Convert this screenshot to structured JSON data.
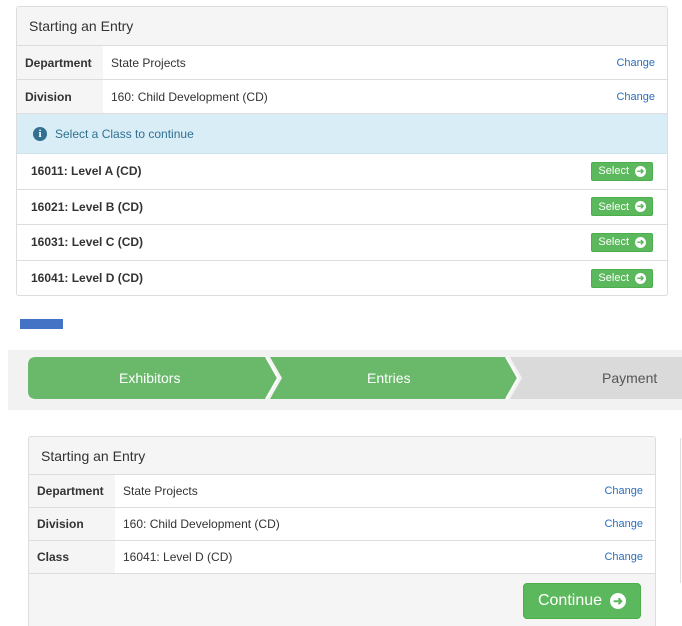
{
  "top_panel": {
    "title": "Starting an Entry",
    "department": {
      "label": "Department",
      "value": "State Projects",
      "action": "Change"
    },
    "division": {
      "label": "Division",
      "value": "160: Child Development (CD)",
      "action": "Change"
    },
    "alert": {
      "icon": "info-circle-icon",
      "text": "Select a Class to continue"
    },
    "classes": [
      {
        "name": "16011: Level A (CD)",
        "button": "Select"
      },
      {
        "name": "16021: Level B (CD)",
        "button": "Select"
      },
      {
        "name": "16031: Level C (CD)",
        "button": "Select"
      },
      {
        "name": "16041: Level D (CD)",
        "button": "Select"
      }
    ]
  },
  "steps": [
    {
      "label": "Exhibitors",
      "state": "complete"
    },
    {
      "label": "Entries",
      "state": "active"
    },
    {
      "label": "Payment",
      "state": "pending"
    }
  ],
  "bottom_panel": {
    "title": "Starting an Entry",
    "department": {
      "label": "Department",
      "value": "State Projects",
      "action": "Change"
    },
    "division": {
      "label": "Division",
      "value": "160: Child Development (CD)",
      "action": "Change"
    },
    "class": {
      "label": "Class",
      "value": "16041: Level D (CD)",
      "action": "Change"
    },
    "continue_label": "Continue"
  },
  "icons": {
    "arrow": "➜",
    "info": "i"
  },
  "colors": {
    "accent_green": "#5cb85c",
    "step_green": "#6ab96a",
    "step_grey": "#dadada",
    "link_blue": "#2a6ebb",
    "alert_bg": "#d9edf7",
    "divider_blue": "#4472c4"
  }
}
